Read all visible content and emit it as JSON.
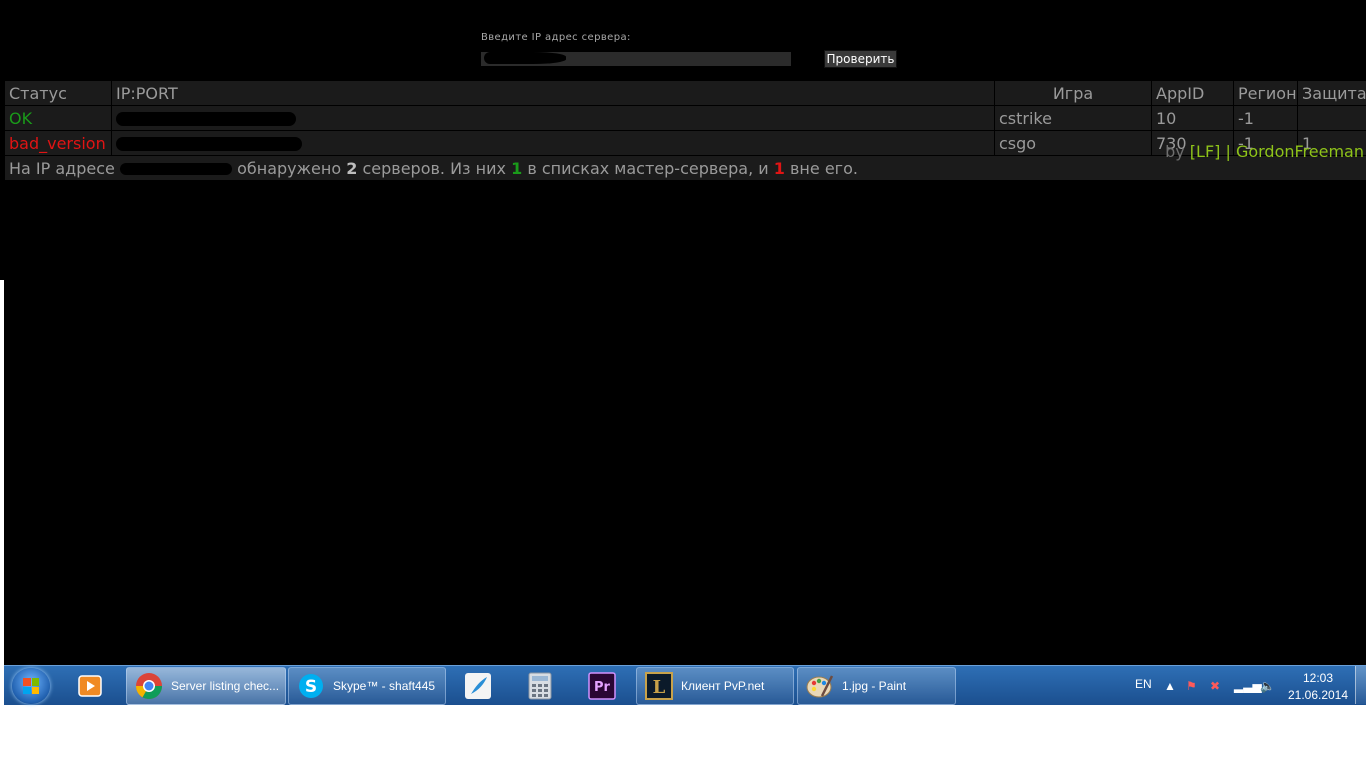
{
  "form": {
    "label": "Введите IP адрес сервера:",
    "input_value": "",
    "button_label": "Проверить"
  },
  "table": {
    "headers": {
      "status": "Статус",
      "ipport": "IP:PORT",
      "game": "Игра",
      "appid": "AppID",
      "region": "Регион",
      "protection": "Защита"
    },
    "rows": [
      {
        "status": "OK",
        "game": "cstrike",
        "appid": "10",
        "region": "-1",
        "protection": ""
      },
      {
        "status": "bad_version",
        "game": "csgo",
        "appid": "730",
        "region": "-1",
        "protection": "1"
      }
    ],
    "summary": {
      "prefix": "На IP адресе",
      "found": "обнаружено",
      "total": "2",
      "servers": "серверов. Из них",
      "in_master": "1",
      "in_master_text": "в списках мастер-сервера, и",
      "outside": "1",
      "outside_text": "вне его."
    }
  },
  "author": {
    "by": "by",
    "nick": "[LF] | GordonFreeman"
  },
  "taskbar": {
    "tasks": [
      {
        "label": "Server listing chec...",
        "icon": "chrome-icon"
      },
      {
        "label": "Skype™ - shaft445",
        "icon": "skype-icon"
      },
      {
        "label": "Клиент PvP.net",
        "icon": "league-of-legends-icon"
      },
      {
        "label": "1.jpg - Paint",
        "icon": "paint-icon"
      }
    ],
    "pinned": [
      "media-player-icon",
      "feather-app-icon",
      "calculator-icon",
      "premiere-pro-icon"
    ],
    "pinned_premiere_text": "Pr",
    "tray": {
      "lang": "EN",
      "time": "12:03",
      "date": "21.06.2014"
    }
  },
  "colors": {
    "ok": "#1a9a1a",
    "bad": "#e01414",
    "nick": "#8fc41a",
    "taskbar": "#1b4f8f"
  }
}
